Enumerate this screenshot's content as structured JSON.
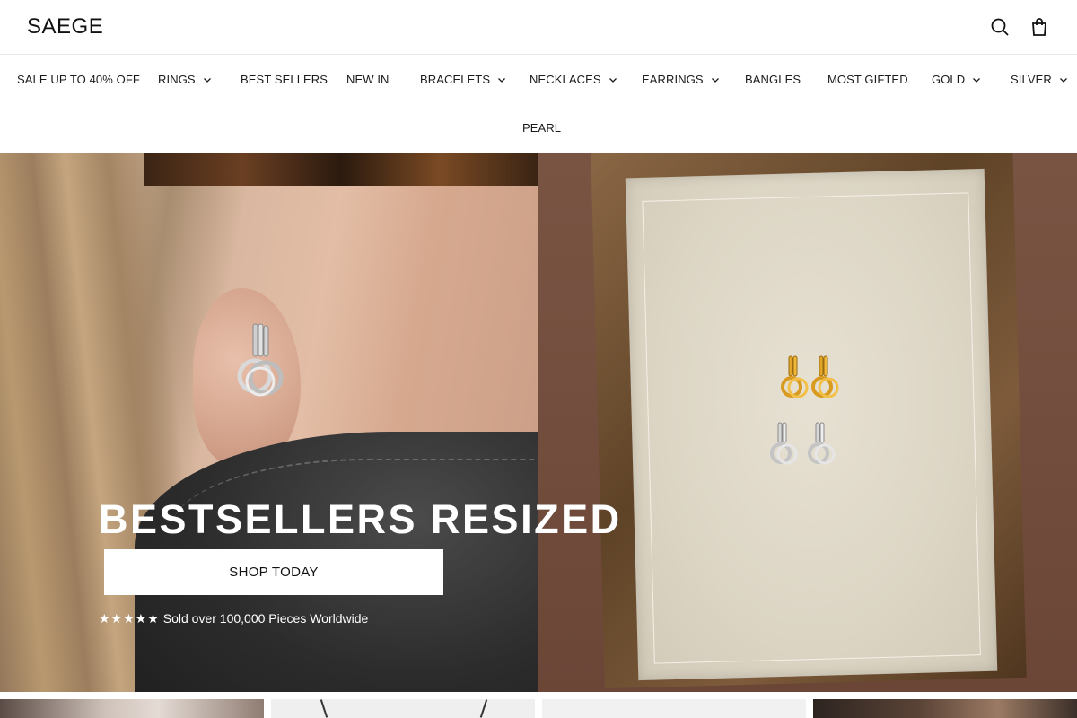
{
  "header": {
    "logo": "SAEGE",
    "search_icon": "search-icon",
    "cart_icon": "shopping-bag-icon"
  },
  "nav": {
    "items": [
      {
        "label": "SALE UP TO 40% OFF",
        "has_dropdown": false
      },
      {
        "label": "RINGS",
        "has_dropdown": true
      },
      {
        "label": "BEST SELLERS",
        "has_dropdown": false
      },
      {
        "label": "NEW IN",
        "has_dropdown": false
      },
      {
        "label": "BRACELETS",
        "has_dropdown": true
      },
      {
        "label": "NECKLACES",
        "has_dropdown": true
      },
      {
        "label": "EARRINGS",
        "has_dropdown": true
      },
      {
        "label": "BANGLES",
        "has_dropdown": false
      },
      {
        "label": "MOST GIFTED",
        "has_dropdown": false
      },
      {
        "label": "GOLD",
        "has_dropdown": true
      },
      {
        "label": "SILVER",
        "has_dropdown": true
      },
      {
        "label": "PEARL",
        "has_dropdown": false
      }
    ]
  },
  "hero": {
    "title": "BESTSELLERS RESIZED",
    "button_label": "SHOP TODAY",
    "stars": "★★★★★",
    "proof_text": "Sold over 100,000 Pieces Worldwide"
  },
  "colors": {
    "text": "#1a1a1a",
    "divider": "#e6e6e6",
    "hero_text": "#ffffff",
    "button_bg": "#ffffff"
  }
}
